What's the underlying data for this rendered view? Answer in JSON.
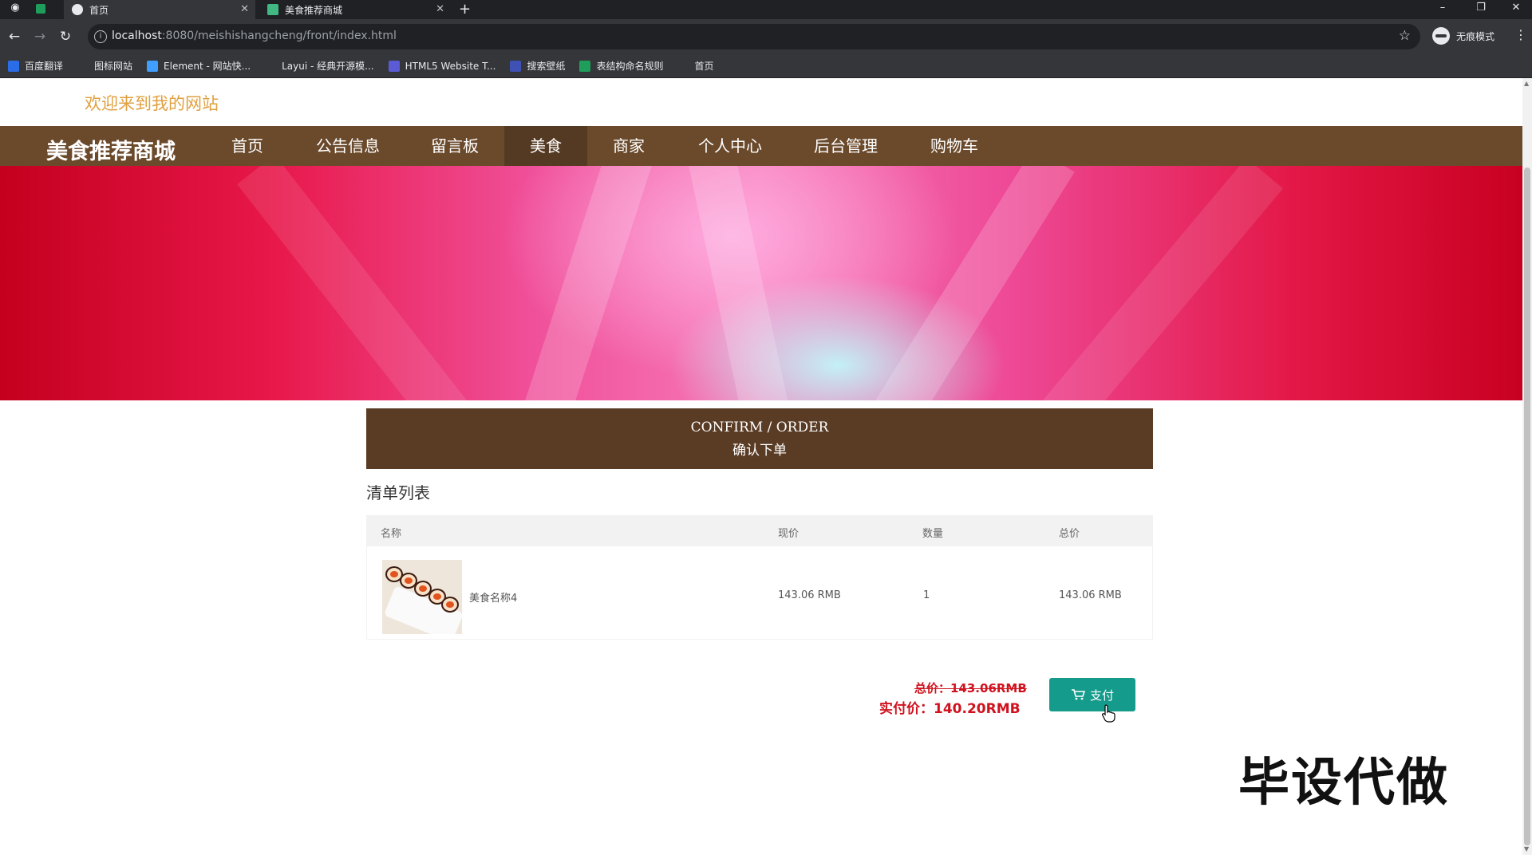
{
  "browser": {
    "tabs": [
      {
        "title": "首页",
        "active": true
      },
      {
        "title": "美食推荐商城",
        "active": false
      }
    ],
    "url_host": "localhost",
    "url_path": ":8080/meishishangcheng/front/index.html",
    "incognito_label": "无痕模式",
    "bookmarks": [
      {
        "label": "百度翻译",
        "icon": "baidu-translate-icon",
        "color": "#2b6de8"
      },
      {
        "label": "图标网站",
        "icon": "flag-icon",
        "color": "#35363a"
      },
      {
        "label": "Element - 网站快...",
        "icon": "element-icon",
        "color": "#409eff"
      },
      {
        "label": "Layui - 经典开源模...",
        "icon": "layui-icon",
        "color": "#35363a"
      },
      {
        "label": "HTML5 Website T...",
        "icon": "html5-icon",
        "color": "#5b5bd6"
      },
      {
        "label": "搜索壁纸",
        "icon": "wallpaper-icon",
        "color": "#3f51b5"
      },
      {
        "label": "表结构命名规则",
        "icon": "sheet-icon",
        "color": "#1e9e5a"
      },
      {
        "label": "首页",
        "icon": "globe-icon",
        "color": "#35363a"
      }
    ]
  },
  "site": {
    "welcome": "欢迎来到我的网站",
    "brand": "美食推荐商城",
    "nav": [
      {
        "label": "首页",
        "active": false
      },
      {
        "label": "公告信息",
        "active": false
      },
      {
        "label": "留言板",
        "active": false
      },
      {
        "label": "美食",
        "active": true
      },
      {
        "label": "商家",
        "active": false
      },
      {
        "label": "个人中心",
        "active": false
      },
      {
        "label": "后台管理",
        "active": false
      },
      {
        "label": "购物车",
        "active": false
      }
    ],
    "colors": {
      "nav_bg": "#6b4a2c",
      "accent_price": "#d0121e",
      "pay_button": "#159b8c",
      "welcome_text": "#e0a040"
    }
  },
  "order": {
    "heading_en": "CONFIRM / ORDER",
    "heading_cn": "确认下单",
    "list_title": "清单列表",
    "columns": [
      "名称",
      "现价",
      "数量",
      "总价"
    ],
    "rows": [
      {
        "name": "美食名称4",
        "price": "143.06 RMB",
        "qty": "1",
        "total": "143.06 RMB"
      }
    ],
    "original_total": "总价：143.06RMB",
    "actual_total": "实付价：140.20RMB",
    "pay_label": "支付"
  },
  "watermark": "毕设代做"
}
